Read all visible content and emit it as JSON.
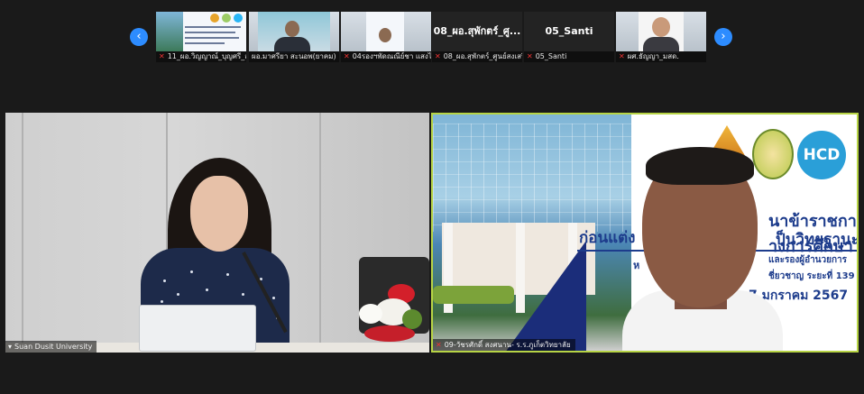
{
  "thumbnails": [
    {
      "label": "11_ผอ.วิญญาณ์_บุญศรี_ส...",
      "muted": true,
      "kind": "slide"
    },
    {
      "label": "ผอ.มาศรียา สะนอพ(ยาคม)",
      "muted": false,
      "kind": "person"
    },
    {
      "label": "04รองฯพัดณณีย์ชา แสงไส",
      "muted": true,
      "kind": "slide-person"
    },
    {
      "label": "08_ผอ.สุพักตร์_ศูนย์สงเสริม...",
      "display_name": "08_ผอ.สุพักตร์_ศู...",
      "muted": true,
      "kind": "name"
    },
    {
      "label": "05_Santi",
      "display_name": "05_Santi",
      "muted": true,
      "kind": "name"
    },
    {
      "label": "ผศ.ธัญญา_มสด.",
      "muted": true,
      "kind": "person"
    }
  ],
  "nav": {
    "prev_icon": "chevron-left-icon",
    "next_icon": "chevron-right-icon",
    "prev_glyph": "‹",
    "next_glyph": "›"
  },
  "main_tiles": {
    "left": {
      "label": "Suan Dusit University",
      "muted": false
    },
    "right": {
      "label": "09-วัชรศักดิ์ สงศนาน- ร.ร.ภูเก็ตวิทยาลัย",
      "muted": true,
      "active_speaker": true,
      "slide_lines": [
        "นาข้าราชการ",
        "างการศึกษา",
        "ก่อนแต่ง",
        "ป็นวิทยฐานะ",
        "ห",
        "และรองผู้อำนวยการ",
        "ชี่ยวชาญ ระยะที่ 139",
        "7 มกราคม 2567"
      ],
      "logo_text": "HCD"
    }
  },
  "colors": {
    "accent": "#2d8cff",
    "active_border": "#b7d445",
    "slide_blue": "#1d3c8c"
  }
}
